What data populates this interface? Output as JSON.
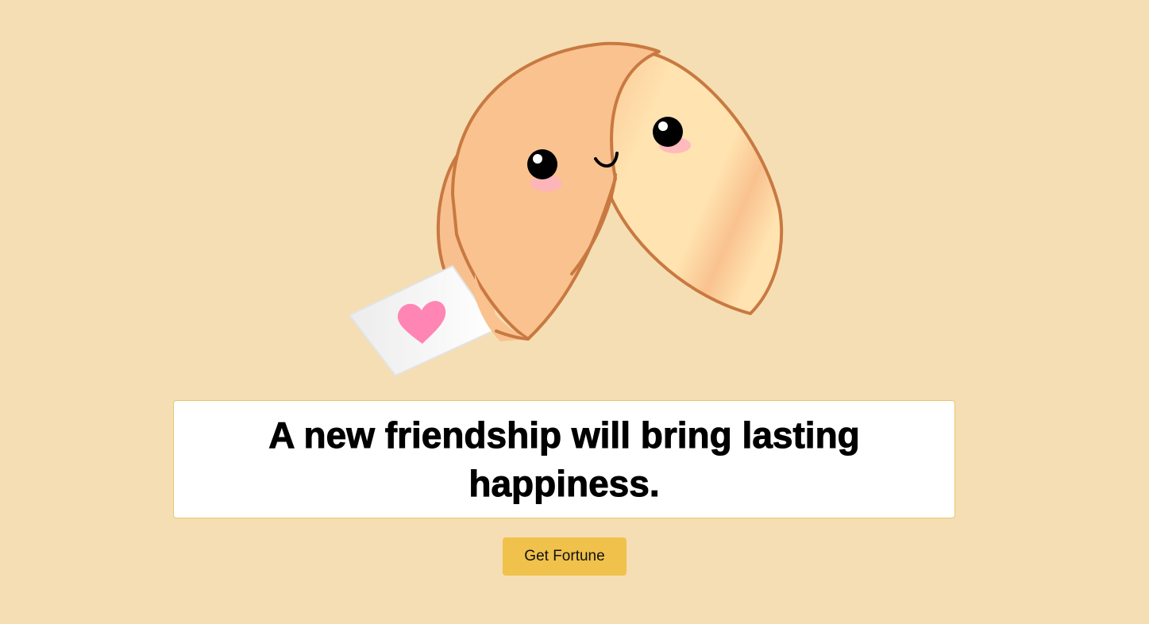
{
  "fortune": {
    "text": "A new friendship will bring lasting happiness."
  },
  "actions": {
    "get_fortune_label": "Get Fortune"
  },
  "illustration": {
    "icon": "fortune-cookie-illustration",
    "colors": {
      "cookie_outline": "#c87941",
      "cookie_fill_light": "#ffe3b0",
      "cookie_fill_dark": "#f9c08f",
      "paper": "#f7f7f7",
      "heart": "#ff85b4",
      "blush": "#ffb3c1"
    }
  },
  "theme": {
    "background": "#f5deb3",
    "button": "#f0c14b",
    "box_border": "#e8c770"
  }
}
